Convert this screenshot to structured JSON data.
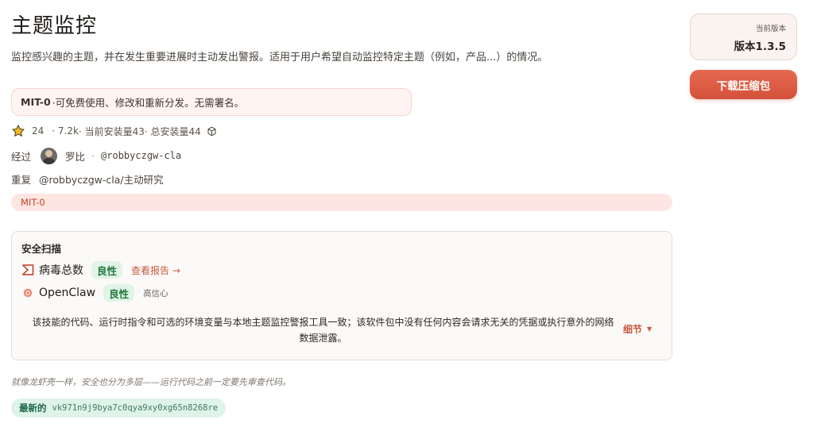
{
  "page": {
    "title": "主题监控",
    "description": "监控感兴趣的主题，并在发生重要进展时主动发出警报。适用于用户希望自动监控特定主题（例如，产品...）的情况。"
  },
  "license_box": {
    "name": "MIT-0",
    "text": "·可免费使用、修改和重新分发。无需署名。"
  },
  "stats": {
    "stars": "24",
    "downloads": "· 7.2k",
    "current_installs": "· 当前安装量43",
    "total_installs": "· 总安装量44"
  },
  "byline": {
    "label": "经过",
    "author_name": "罗比",
    "dot": "·",
    "author_handle": "@robbyczgw-cla"
  },
  "fork": {
    "label": "重复",
    "path": "@robbyczgw-cla/主动研究"
  },
  "license_pill": "MIT-0",
  "security_scan": {
    "title": "安全扫描",
    "virustotal": {
      "name": "病毒总数",
      "verdict": "良性",
      "report_link": "查看报告 →"
    },
    "openclaw": {
      "name": "OpenClaw",
      "verdict": "良性",
      "confidence": "高信心"
    },
    "summary": "该技能的代码、运行时指令和可选的环境变量与本地主题监控警报工具一致；该软件包中没有任何内容会请求无关的凭据或执行意外的网络数据泄露。",
    "details_label": "细节"
  },
  "note": "就像龙虾壳一样，安全也分为多层——运行代码之前一定要先审查代码。",
  "latest": {
    "label": "最新的",
    "hash": "vk971n9j9bya7c0qya9xy0xg65n8268re"
  },
  "sidebar": {
    "version_label": "当前版本",
    "version_value": "版本1.3.5",
    "download_button": "下载压缩包"
  },
  "colors": {
    "accent": "#d9563e",
    "benign_bg": "#e2f3e7",
    "benign_text": "#1f7a3d",
    "license_bg": "#fde6e1",
    "star": "#f2b81e"
  },
  "icons": [
    "star-icon",
    "package-icon",
    "virustotal-icon",
    "openclaw-icon",
    "caret-down-icon",
    "avatar"
  ]
}
